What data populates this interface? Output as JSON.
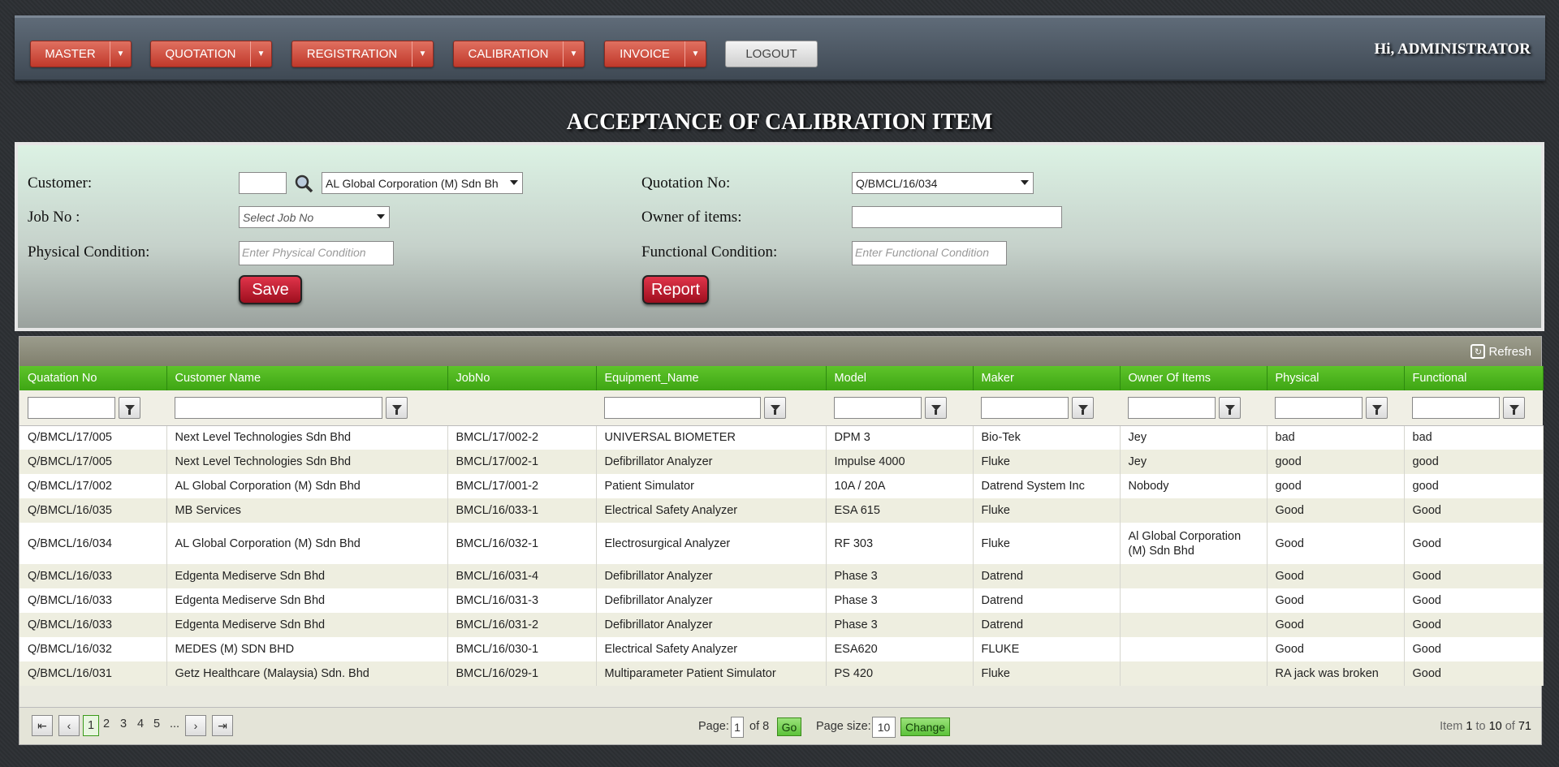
{
  "header": {
    "menu": [
      {
        "label": "MASTER"
      },
      {
        "label": "QUOTATION"
      },
      {
        "label": "REGISTRATION"
      },
      {
        "label": "CALIBRATION"
      },
      {
        "label": "INVOICE"
      }
    ],
    "logout_label": "LOGOUT",
    "greeting": "Hi, ADMINISTRATOR"
  },
  "page_title": "ACCEPTANCE OF CALIBRATION ITEM",
  "form": {
    "customer_label": "Customer:",
    "customer_code": "",
    "customer_select": "AL Global Corporation (M) Sdn Bh",
    "jobno_label": "Job No :",
    "jobno_select": "Select Job No",
    "physical_label": "Physical Condition:",
    "physical_placeholder": "Enter Physical Condition",
    "quotation_label": "Quotation No:",
    "quotation_select": "Q/BMCL/16/034",
    "owner_label": "Owner of items:",
    "owner_value": "",
    "functional_label": "Functional Condition:",
    "functional_placeholder": "Enter Functional Condition",
    "save_label": "Save",
    "report_label": "Report"
  },
  "grid": {
    "refresh_label": "Refresh",
    "columns": [
      "Quatation No",
      "Customer Name",
      "JobNo",
      "Equipment_Name",
      "Model",
      "Maker",
      "Owner Of Items",
      "Physical",
      "Functional"
    ],
    "rows": [
      [
        "Q/BMCL/17/005",
        "Next Level Technologies Sdn Bhd",
        "BMCL/17/002-2",
        "UNIVERSAL BIOMETER",
        "DPM 3",
        "Bio-Tek",
        "Jey",
        "bad",
        "bad"
      ],
      [
        "Q/BMCL/17/005",
        "Next Level Technologies Sdn Bhd",
        "BMCL/17/002-1",
        "Defibrillator Analyzer",
        "Impulse 4000",
        "Fluke",
        "Jey",
        "good",
        "good"
      ],
      [
        "Q/BMCL/17/002",
        "AL Global Corporation (M) Sdn Bhd",
        "BMCL/17/001-2",
        "Patient Simulator",
        "10A / 20A",
        "Datrend System Inc",
        "Nobody",
        "good",
        "good"
      ],
      [
        "Q/BMCL/16/035",
        "MB Services",
        "BMCL/16/033-1",
        "Electrical Safety Analyzer",
        "ESA 615",
        "Fluke",
        "",
        "Good",
        "Good"
      ],
      [
        "Q/BMCL/16/034",
        "AL Global Corporation (M) Sdn Bhd",
        "BMCL/16/032-1",
        "Electrosurgical Analyzer",
        "RF 303",
        "Fluke",
        "Al Global Corporation (M) Sdn Bhd",
        "Good",
        "Good"
      ],
      [
        "Q/BMCL/16/033",
        "Edgenta Mediserve Sdn Bhd",
        "BMCL/16/031-4",
        "Defibrillator Analyzer",
        "Phase 3",
        "Datrend",
        "",
        "Good",
        "Good"
      ],
      [
        "Q/BMCL/16/033",
        "Edgenta Mediserve Sdn Bhd",
        "BMCL/16/031-3",
        "Defibrillator Analyzer",
        "Phase 3",
        "Datrend",
        "",
        "Good",
        "Good"
      ],
      [
        "Q/BMCL/16/033",
        "Edgenta Mediserve Sdn Bhd",
        "BMCL/16/031-2",
        "Defibrillator Analyzer",
        "Phase 3",
        "Datrend",
        "",
        "Good",
        "Good"
      ],
      [
        "Q/BMCL/16/032",
        "MEDES (M) SDN BHD",
        "BMCL/16/030-1",
        "Electrical Safety Analyzer",
        "ESA620",
        "FLUKE",
        "",
        "Good",
        "Good"
      ],
      [
        "Q/BMCL/16/031",
        "Getz Healthcare (Malaysia) Sdn. Bhd",
        "BMCL/16/029-1",
        "Multiparameter Patient Simulator",
        "PS 420",
        "Fluke",
        "",
        "RA jack was broken",
        "Good"
      ]
    ]
  },
  "pager": {
    "pages": [
      "1",
      "2",
      "3",
      "4",
      "5",
      "..."
    ],
    "page_label": "Page:",
    "page_value": "1",
    "of_label": "of 8",
    "go_label": "Go",
    "size_label": "Page size:",
    "size_value": "10",
    "change_label": "Change",
    "item_prefix": "Item",
    "item_from": "1",
    "item_to_label": "to",
    "item_to": "10",
    "item_of_label": "of",
    "item_total": "71"
  }
}
